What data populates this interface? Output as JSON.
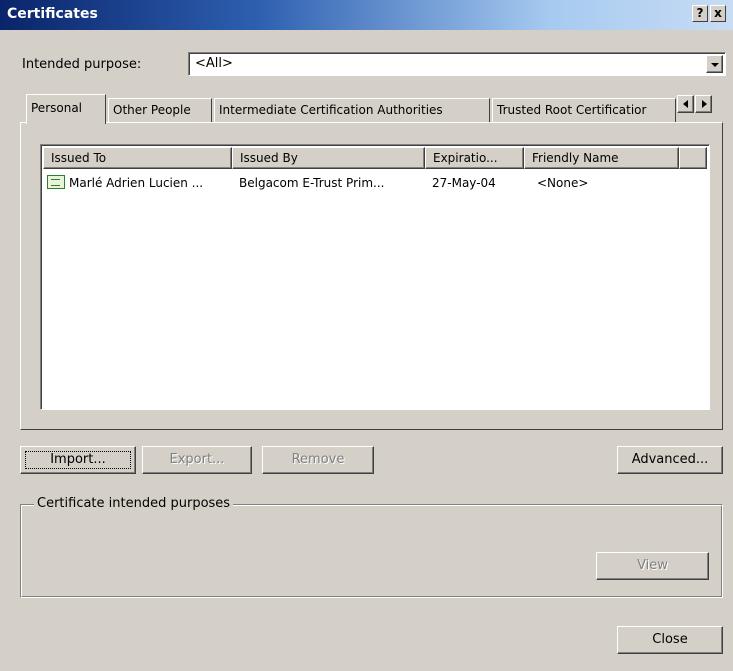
{
  "window": {
    "title": "Certificates",
    "help_glyph": "?",
    "close_glyph": "x"
  },
  "purpose": {
    "label": "Intended purpose:",
    "label_hotkey": "n",
    "value": "<All>"
  },
  "tabs": [
    {
      "label": "Personal",
      "active": true
    },
    {
      "label": "Other People",
      "active": false
    },
    {
      "label": "Intermediate Certification Authorities",
      "active": false
    },
    {
      "label": "Trusted Root Certificatior",
      "active": false
    }
  ],
  "list": {
    "columns": [
      "Issued To",
      "Issued By",
      "Expiratio...",
      "Friendly Name"
    ],
    "rows": [
      {
        "issued_to": "Marlé Adrien Lucien ...",
        "issued_by": "Belgacom E-Trust Prim...",
        "expiration": "27-May-04",
        "friendly_name": "<None>"
      }
    ]
  },
  "buttons": {
    "import": "Import...",
    "export": "Export...",
    "remove": "Remove",
    "advanced": "Advanced...",
    "view": "View",
    "close": "Close"
  },
  "purposes_group": {
    "label": "Certificate intended purposes"
  },
  "colors": {
    "face": "#d4d0c8",
    "title_active": "#0a246a",
    "disabled_text": "#808080"
  }
}
